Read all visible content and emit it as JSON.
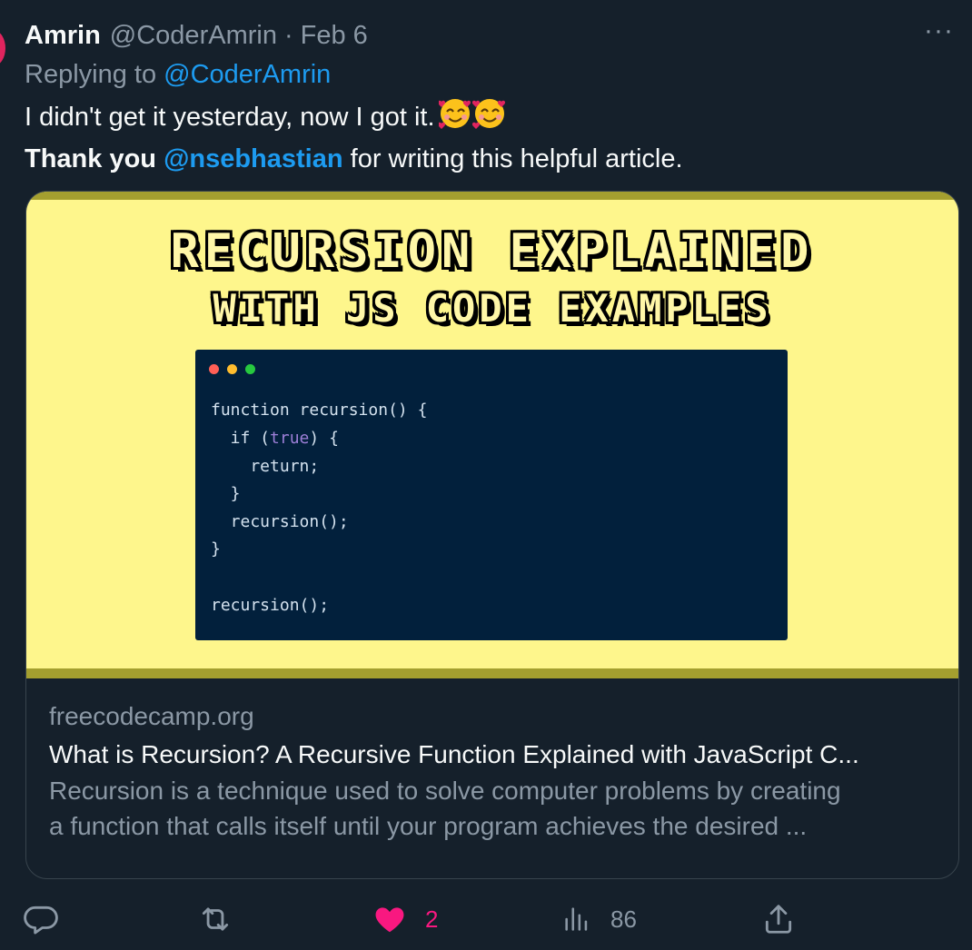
{
  "tweet": {
    "author_name": "Amrin",
    "handle": "@CoderAmrin",
    "separator": "·",
    "date": "Feb 6",
    "replying_prefix": "Replying to",
    "replying_to": "@CoderAmrin",
    "line1": "I didn't get it yesterday, now I got it.",
    "line2_bold": "Thank you",
    "mention": "@nsebhastian",
    "line2_rest": "for writing this helpful article.",
    "more_label": "···"
  },
  "card": {
    "image_title_line1": "RECURSION EXPLAINED",
    "image_title_line2": "WITH JS CODE EXAMPLES",
    "code": {
      "l1": "function recursion() {",
      "l2_a": "  if (",
      "l2_true": "true",
      "l2_b": ") {",
      "l3": "    return;",
      "l4": "  }",
      "l5": "  recursion();",
      "l6": "}",
      "l7": "recursion();"
    },
    "domain": "freecodecamp.org",
    "title": "What is Recursion? A Recursive Function Explained with JavaScript C...",
    "description_line1": "Recursion is a technique used to solve computer problems by creating",
    "description_line2": "a function that calls itself until your program achieves the desired ..."
  },
  "actions": {
    "likes": "2",
    "views": "86"
  },
  "colors": {
    "background": "#15202b",
    "link": "#1d9bf0",
    "like": "#f91880",
    "muted": "#8b98a5",
    "card_image_bg": "#fef68c",
    "code_bg": "#02203c"
  },
  "icons": [
    "reply-icon",
    "retweet-icon",
    "heart-icon",
    "views-icon",
    "share-icon",
    "smiling-face-with-hearts-emoji",
    "more-icon"
  ]
}
